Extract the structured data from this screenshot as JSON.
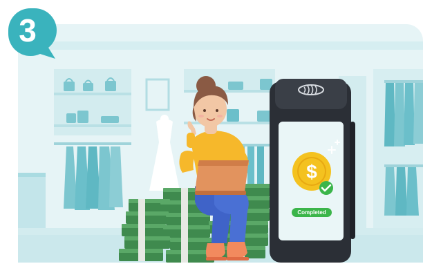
{
  "step": {
    "number": "3"
  },
  "terminal": {
    "status_label": "Completed",
    "currency_symbol": "$"
  },
  "icons": [
    "speech-badge-icon",
    "contactless-icon",
    "dollar-coin-icon",
    "check-icon",
    "sparkle-icon",
    "handbag-icon",
    "dress-icon"
  ],
  "colors": {
    "brand_teal": "#3ab3bd",
    "store_bg": "#e3f3f5",
    "shelf": "#c9e8ec",
    "terminal_body": "#2b2f36",
    "coin_gold": "#f4c21f",
    "status_green": "#3bb54a",
    "sweater_yellow": "#f6b82b",
    "jeans_blue": "#3f63c8"
  }
}
